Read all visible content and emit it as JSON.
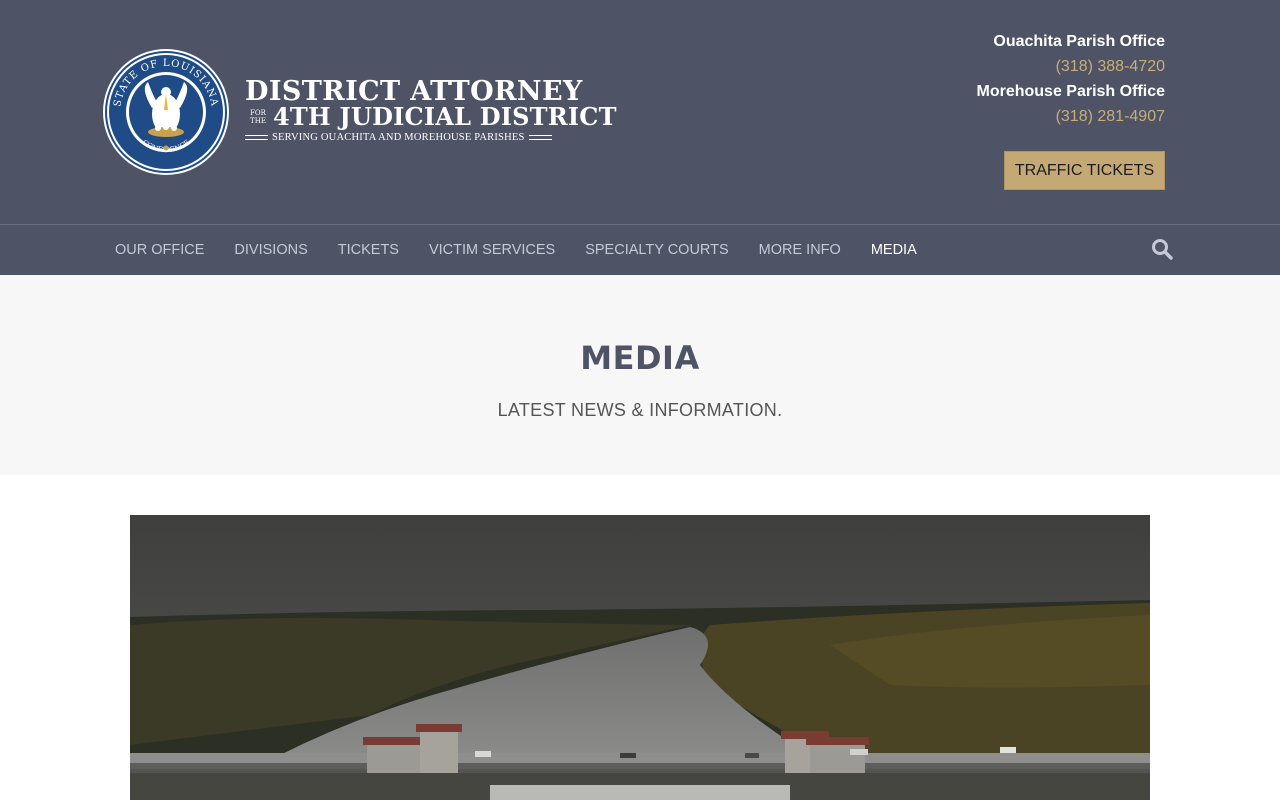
{
  "branding": {
    "seal_alt": "State of Louisiana seal",
    "seal_text_top": "STATE OF LOUISIANA",
    "seal_text_bottom": "CONFIDENCE",
    "seal_motto": "UNION · JUSTICE",
    "title_line1": "DISTRICT ATTORNEY",
    "for_the": "FOR THE",
    "title_line2": "4TH JUDICIAL DISTRICT",
    "subtitle": "SERVING OUACHITA AND MOREHOUSE PARISHES"
  },
  "contact": {
    "offices": [
      {
        "name": "Ouachita Parish Office",
        "phone": "(318) 388-4720"
      },
      {
        "name": "Morehouse Parish Office",
        "phone": "(318) 281-4907"
      }
    ],
    "cta_label": "TRAFFIC TICKETS"
  },
  "nav": {
    "items": [
      {
        "label": "OUR OFFICE"
      },
      {
        "label": "DIVISIONS"
      },
      {
        "label": "TICKETS"
      },
      {
        "label": "VICTIM SERVICES"
      },
      {
        "label": "SPECIALTY COURTS"
      },
      {
        "label": "MORE INFO"
      },
      {
        "label": "MEDIA"
      }
    ],
    "active_item": "MEDIA",
    "search_icon": "search-icon"
  },
  "hero": {
    "title": "MEDIA",
    "subtitle": "LATEST NEWS & INFORMATION."
  },
  "colors": {
    "header_bg": "#4f5366",
    "accent_gold": "#c4a974",
    "phone_gold": "#c9ad76",
    "hero_bg": "#f7f7f7",
    "title_color": "#4f5366"
  }
}
